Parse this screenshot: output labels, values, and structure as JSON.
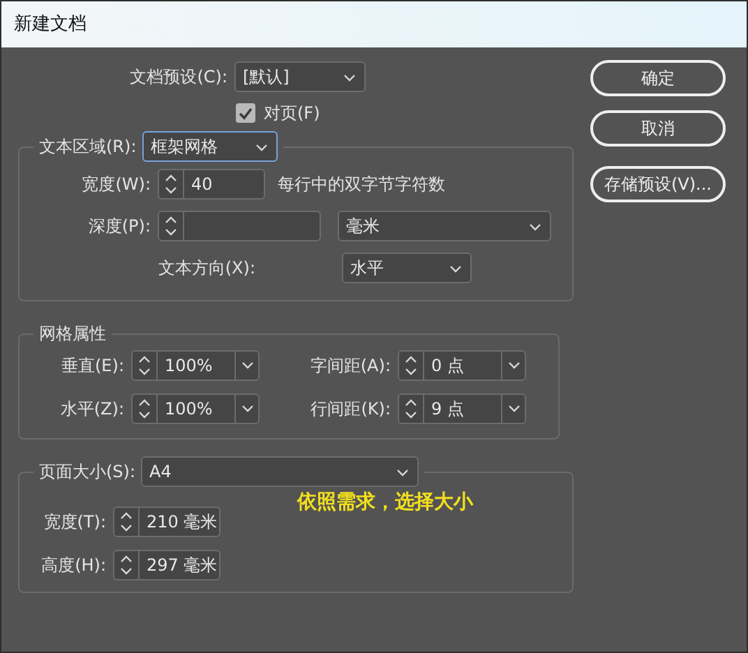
{
  "window": {
    "title": "新建文档"
  },
  "document_preset": {
    "label": "文档预设(C):",
    "value": "[默认]"
  },
  "facing_pages": {
    "label": "对页(F)",
    "checked": true
  },
  "text_area": {
    "label": "文本区域(R):",
    "value": "框架网格",
    "focused": true,
    "width": {
      "label": "宽度(W):",
      "value": "40",
      "note": "每行中的双字节字符数"
    },
    "depth": {
      "label": "深度(P):",
      "unit": "毫米"
    },
    "direction": {
      "label": "文本方向(X):",
      "value": "水平"
    }
  },
  "grid_attributes": {
    "title": "网格属性",
    "fields": [
      {
        "label": "垂直(E):",
        "value": "100%"
      },
      {
        "label": "字间距(A):",
        "value": "0 点"
      },
      {
        "label": "水平(Z):",
        "value": "100%"
      },
      {
        "label": "行间距(K):",
        "value": "9 点"
      }
    ]
  },
  "page_size": {
    "label": "页面大小(S):",
    "value": "A4",
    "width": {
      "label": "宽度(T):",
      "value": "210 毫米"
    },
    "height": {
      "label": "高度(H):",
      "value": "297 毫米"
    }
  },
  "annotation": "依照需求，选择大小",
  "buttons": [
    {
      "label": "确定"
    },
    {
      "label": "取消"
    },
    {
      "label": "存储预设(V)..."
    }
  ]
}
